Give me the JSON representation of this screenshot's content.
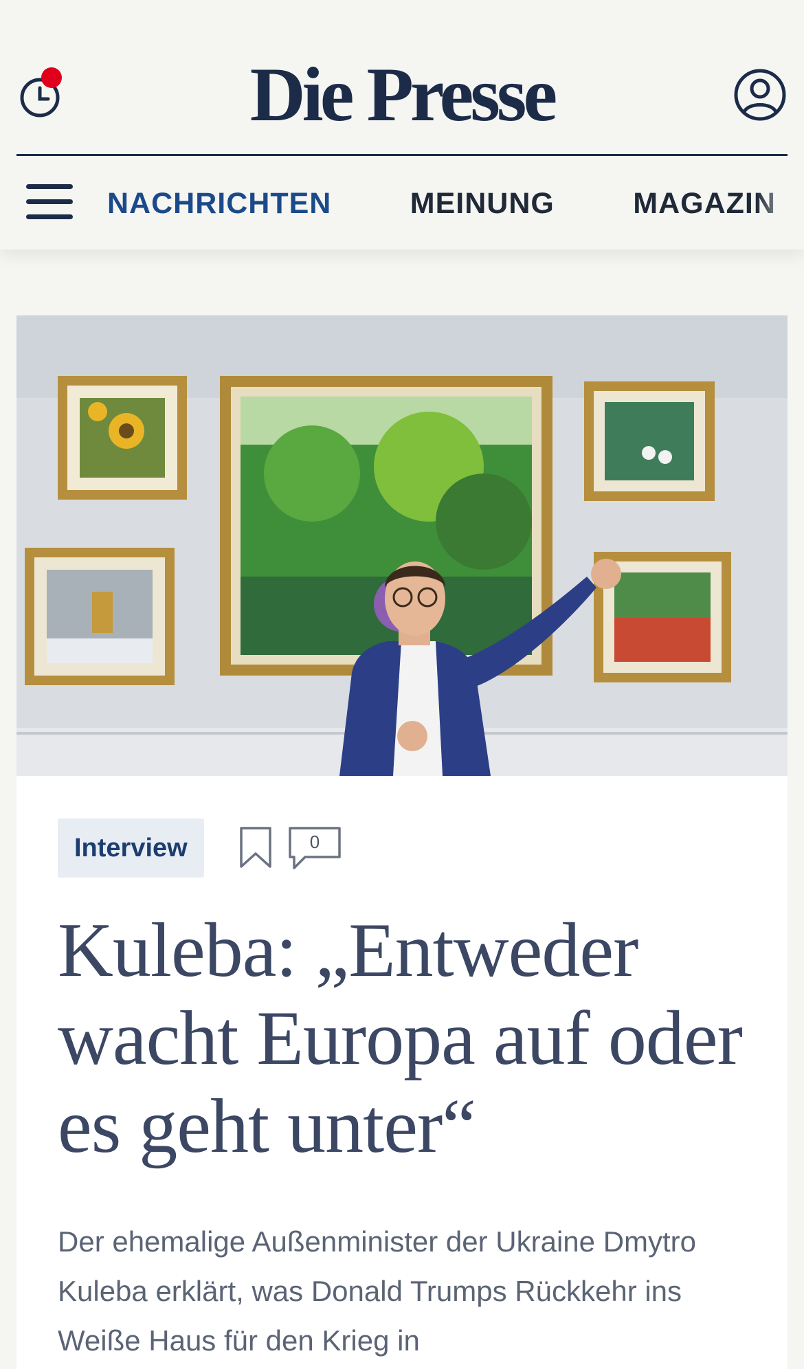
{
  "header": {
    "logo": "Die Presse",
    "history_icon": "clock-history-icon",
    "account_icon": "user-account-icon",
    "menu_icon": "hamburger-menu-icon",
    "notification_color": "#e0001b",
    "brand_color": "#1c2b48"
  },
  "nav": {
    "items": [
      {
        "label": "NACHRICHTEN",
        "active": true
      },
      {
        "label": "MEINUNG",
        "active": false
      },
      {
        "label": "MAGAZIN",
        "active": false
      }
    ],
    "active_color": "#1b4a8a"
  },
  "article": {
    "category": "Interview",
    "bookmark_icon": "bookmark-icon",
    "comment_icon": "comment-icon",
    "comment_count": "0",
    "headline": "Kuleba: „Entweder wacht Europa auf oder es geht unter“",
    "lead": "Der ehemalige Außenminister der Ukraine Dmytro Kuleba erklärt, was Donald Trumps Rückkehr ins Weiße Haus für den Krieg in"
  }
}
